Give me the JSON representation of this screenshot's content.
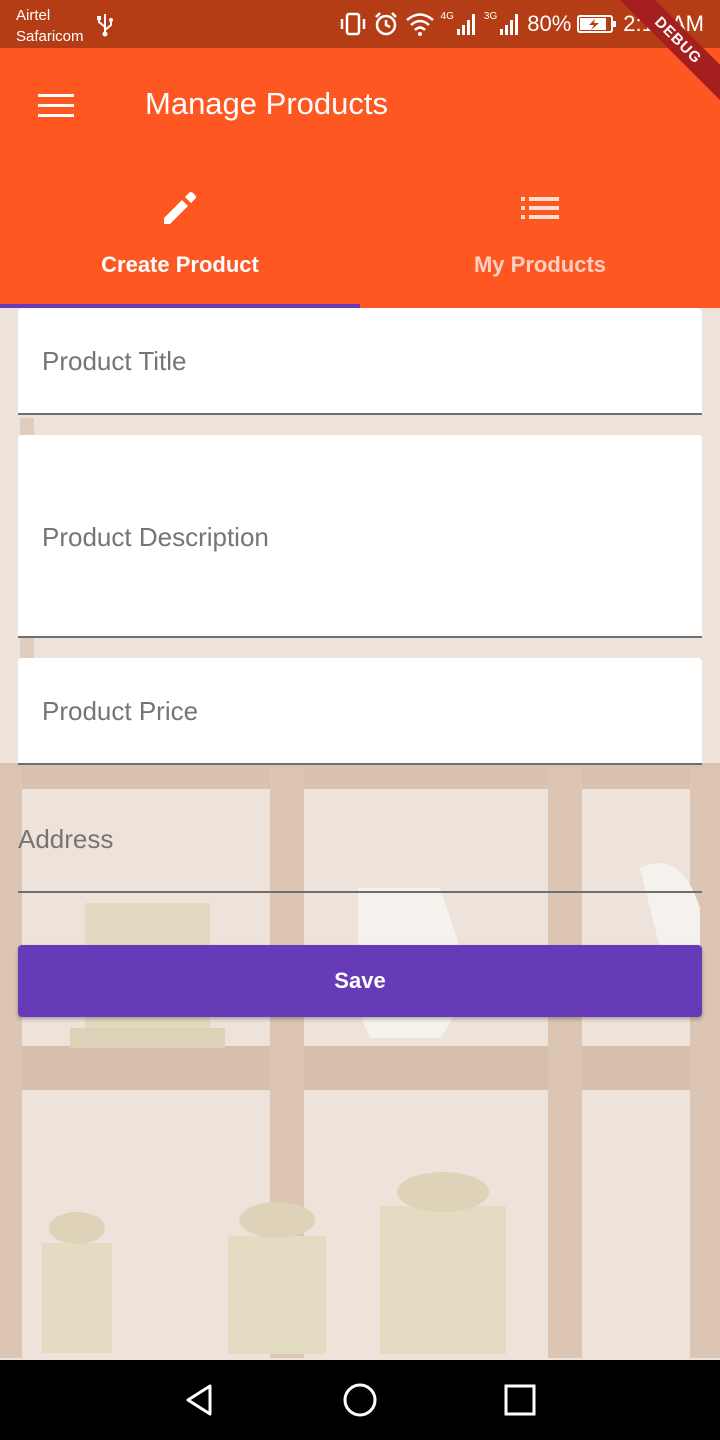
{
  "status_bar": {
    "carrier_1": "Airtel",
    "carrier_2": "Safaricom",
    "network_1": "4G",
    "network_2": "3G",
    "battery": "80%",
    "time": "2:13 AM",
    "icons": [
      "usb-icon",
      "vibrate-icon",
      "alarm-icon",
      "wifi-icon",
      "signal-icon",
      "signal-icon",
      "battery-charging-icon"
    ]
  },
  "debug_banner": "DEBUG",
  "app_bar": {
    "title": "Manage Products",
    "color": "#ff5722"
  },
  "tabs": [
    {
      "label": "Create Product",
      "icon": "edit-icon",
      "selected": true
    },
    {
      "label": "My Products",
      "icon": "list-icon",
      "selected": false
    }
  ],
  "form": {
    "title_placeholder": "Product Title",
    "description_placeholder": "Product Description",
    "price_placeholder": "Product Price",
    "address_placeholder": "Address",
    "save_label": "Save"
  },
  "colors": {
    "accent": "#673ab7",
    "status_bar": "#b53d16"
  },
  "nav_bar": {
    "icons": [
      "back-icon",
      "home-icon",
      "recents-icon"
    ]
  }
}
